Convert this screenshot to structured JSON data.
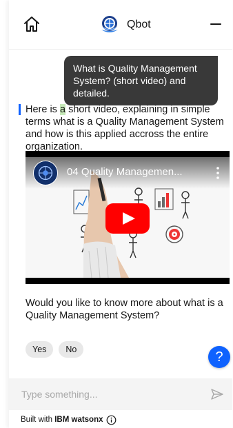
{
  "header": {
    "bot_name": "Qbot",
    "home_icon": "home-icon",
    "logo_icon": "bot-avatar-icon",
    "minimize_icon": "minimize-icon"
  },
  "conversation": {
    "user_message": "What is Quality Management System? (short video) and detailed.",
    "bot_message": {
      "before_highlight": "Here is ",
      "highlight": "a",
      "after_highlight": " short video, explaining in simple terms what is a Quality Management System and how is this applied accross the entire organization."
    },
    "video": {
      "title": "04 Quality Managemen...",
      "channel_logo_icon": "channel-logo-icon",
      "menu_icon": "more-vertical-icon",
      "play_icon": "youtube-play-icon"
    },
    "question": "Would you like to know more about what is a Quality Management System?",
    "options": [
      {
        "label": "Yes"
      },
      {
        "label": "No"
      }
    ]
  },
  "help_button": {
    "label": "?"
  },
  "input": {
    "placeholder": "Type something...",
    "value": "",
    "send_icon": "send-icon"
  },
  "footer": {
    "prefix": "Built with ",
    "brand": "IBM watsonx",
    "info_icon": "info-icon"
  },
  "colors": {
    "accent": "#0f62fe",
    "user_bubble": "#393939",
    "highlight": "#c7eab9",
    "youtube_red": "#ff0000"
  }
}
